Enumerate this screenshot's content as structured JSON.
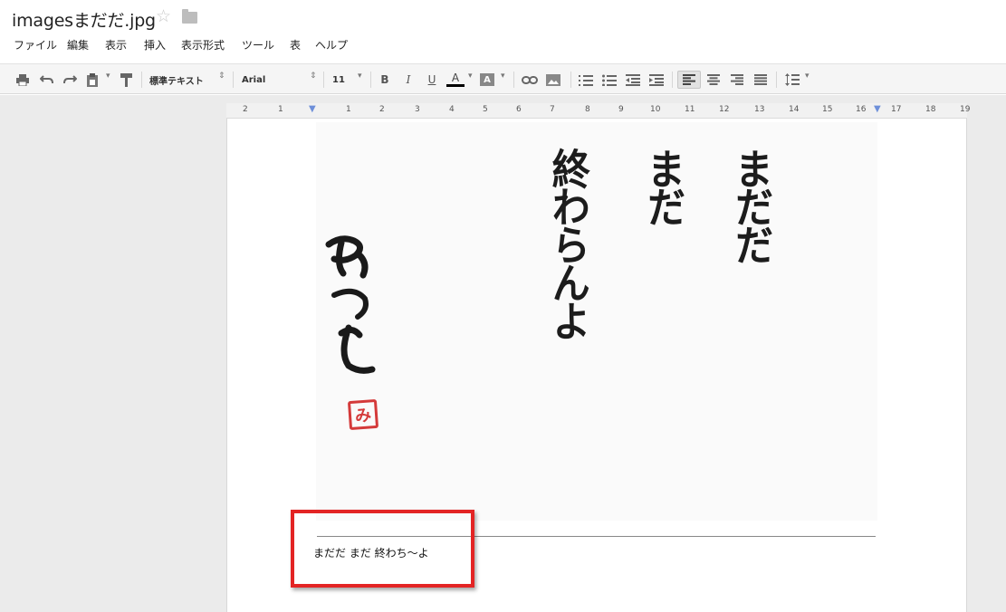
{
  "document": {
    "title": "imagesまだだ.jpg",
    "star_symbol": "☆"
  },
  "menu": {
    "items": [
      "ファイル",
      "編集",
      "表示",
      "挿入",
      "表示形式",
      "ツール",
      "表",
      "ヘルプ"
    ]
  },
  "toolbar": {
    "style_select": "標準テキスト",
    "font_select": "Arial",
    "size_select": "11",
    "bold": "B",
    "italic": "I",
    "underline": "U",
    "text_color": "A",
    "highlight": "A",
    "text_color_value": "#000000"
  },
  "ruler": {
    "left_labels": [
      "2",
      "1"
    ],
    "labels": [
      "1",
      "2",
      "3",
      "4",
      "5",
      "6",
      "7",
      "8",
      "9",
      "10",
      "11",
      "12",
      "13",
      "14",
      "15",
      "16",
      "17",
      "18",
      "19"
    ]
  },
  "image": {
    "column_1": "まだだ",
    "column_2": "まだ",
    "column_3": "終わらんよ",
    "signature": "みつを",
    "seal_char": "み"
  },
  "footnote": {
    "text": "まだだ まだ 終わち～よ"
  },
  "colors": {
    "highlight_box": "#e32424",
    "seal": "#d43a3a"
  }
}
